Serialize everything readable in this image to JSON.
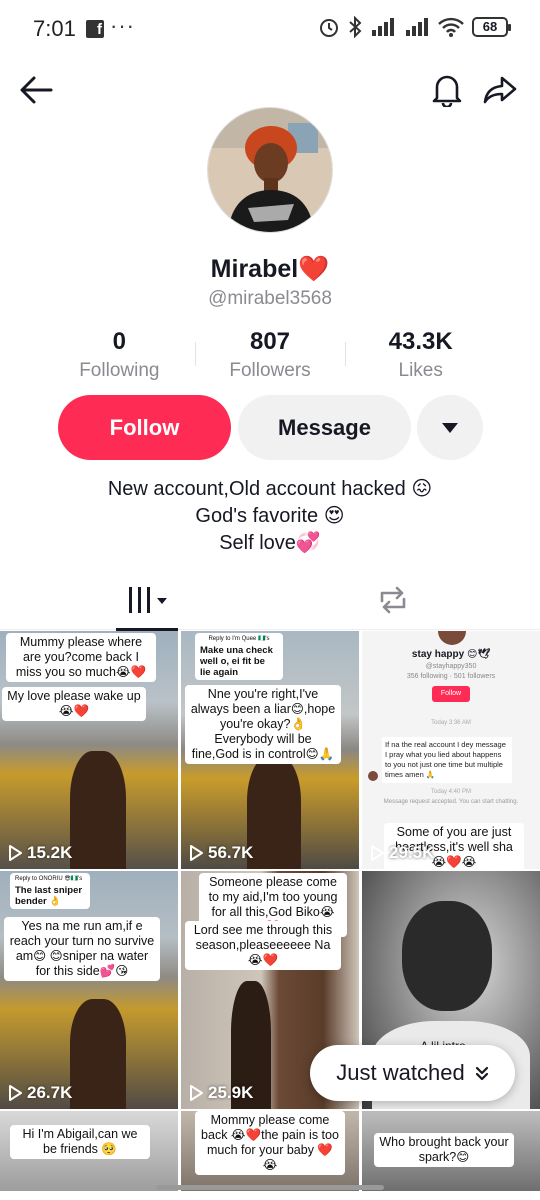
{
  "status": {
    "time": "7:01",
    "fb": "f",
    "dots": "···",
    "battery": "68"
  },
  "profile": {
    "name": "Mirabel❤️",
    "handle": "@mirabel3568"
  },
  "stats": [
    {
      "value": "0",
      "label": "Following"
    },
    {
      "value": "807",
      "label": "Followers"
    },
    {
      "value": "43.3K",
      "label": "Likes"
    }
  ],
  "actions": {
    "follow": "Follow",
    "message": "Message"
  },
  "bio": [
    "New account,Old account hacked 😖",
    "God's favorite 😍",
    "Self love💞"
  ],
  "videos": [
    {
      "views": "15.2K",
      "captions": [
        "Mummy please where are you?come back I miss you so much😭❤️",
        "My love please wake up😭❤️"
      ]
    },
    {
      "views": "56.7K",
      "captions": [
        "Reply to I'm Quee 🇳🇬's comment",
        "Make una check well o, ei fit be lie again",
        "Nne you're right,I've always been a liar😊,hope you're okay?👌 Everybody will be fine,God is in control😊🙏"
      ]
    },
    {
      "views": "29.5K",
      "captions": [
        "stay happy 😊🕊",
        "@stayhappy350",
        "356 following · 501 followers",
        "Follow",
        "Today 3:36 AM",
        "If na the real account I dey message I pray what you lied about happens to you not just one time but multiple times amen 🙏",
        "Today 4:40 PM",
        "Message request accepted. You can start chatting.",
        "Some of you are just heartless,it's well sha😭❤️😭"
      ]
    },
    {
      "views": "26.7K",
      "captions": [
        "Reply to ONORIU 😎🇳🇬's comment",
        "The last sniper bender 👌",
        "Yes na me run am,if e reach your turn no survive am😊 😊sniper na water for this side💕😘"
      ]
    },
    {
      "views": "25.9K",
      "captions": [
        "Someone please come to my aid,I'm too young for all this,God Biko😭❤️",
        "Lord see me through this season,pleaseeeeee Na 😭❤️"
      ]
    },
    {
      "views": "",
      "captions": [
        "A lil intro"
      ]
    },
    {
      "views": "",
      "captions": [
        "Hi I'm Abigail,can we be friends 🥺"
      ]
    },
    {
      "views": "",
      "captions": [
        "Mommy please come back 😭❤️the pain is too much for your baby ❤️😭"
      ]
    },
    {
      "views": "",
      "captions": [
        "Who brought back your spark?😊"
      ]
    }
  ],
  "just_watched": "Just watched",
  "colors": {
    "accent": "#fe2c55",
    "secondary_bg": "#f1f1f2",
    "muted_text": "#8a8b91"
  }
}
